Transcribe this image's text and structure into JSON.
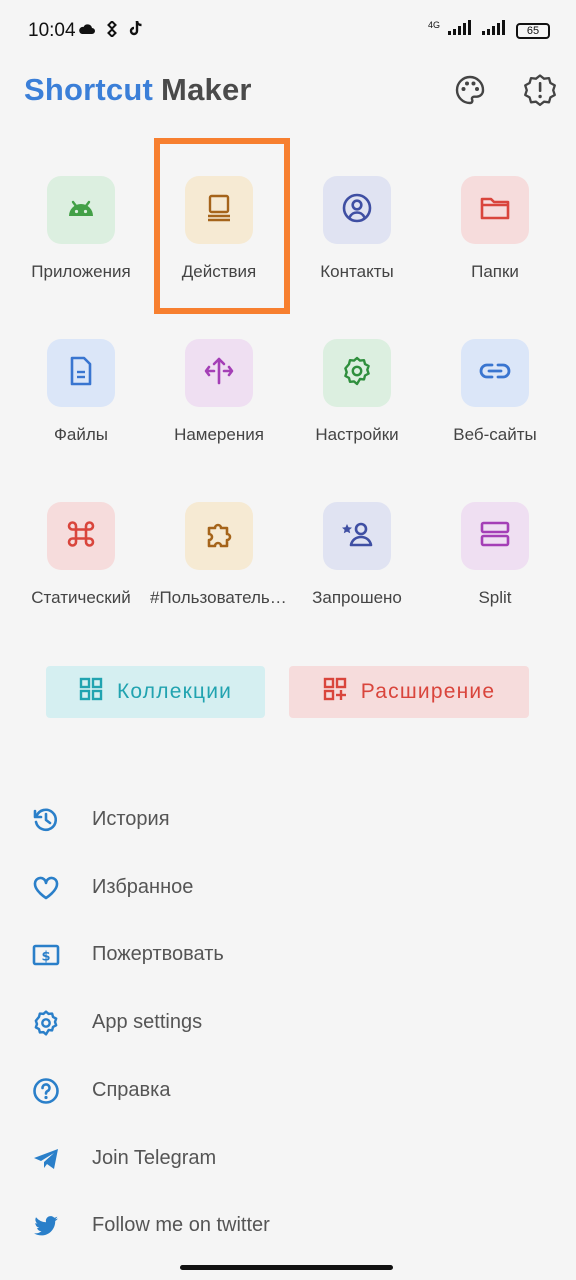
{
  "status_bar": {
    "time": "10:04",
    "network": "4G",
    "battery": "65",
    "icons": [
      "cloud-icon",
      "binance-icon",
      "tiktok-icon",
      "signal-icon",
      "signal-icon",
      "battery-icon"
    ]
  },
  "header": {
    "title_part1": "Shortcut",
    "title_part2": "Maker",
    "palette_icon": "palette-icon",
    "settings_icon": "settings-alert-icon"
  },
  "tiles": [
    {
      "label": "Приложения",
      "icon": "android-icon",
      "bg": "#dcefe0",
      "color": "#43a047"
    },
    {
      "label": "Действия",
      "icon": "activity-icon",
      "bg": "#f6ead3",
      "color": "#a5641a"
    },
    {
      "label": "Контакты",
      "icon": "contact-icon",
      "bg": "#e0e3f2",
      "color": "#3f4fa3"
    },
    {
      "label": "Папки",
      "icon": "folder-icon",
      "bg": "#f6dcdc",
      "color": "#d9453c"
    },
    {
      "label": "Файлы",
      "icon": "file-icon",
      "bg": "#dbe6f8",
      "color": "#3975d0"
    },
    {
      "label": "Намерения",
      "icon": "intent-icon",
      "bg": "#efdff2",
      "color": "#a43fb6"
    },
    {
      "label": "Настройки",
      "icon": "gear-icon",
      "bg": "#dcefe0",
      "color": "#2f8f3d"
    },
    {
      "label": "Веб-сайты",
      "icon": "link-icon",
      "bg": "#dbe6f8",
      "color": "#3975d0"
    },
    {
      "label": "Статический",
      "icon": "command-icon",
      "bg": "#f6dcdc",
      "color": "#d9453c"
    },
    {
      "label": "#Пользовательский",
      "icon": "puzzle-icon",
      "bg": "#f6ead3",
      "color": "#a5641a"
    },
    {
      "label": "Запрошено",
      "icon": "requested-user-icon",
      "bg": "#e0e3f2",
      "color": "#3f4fa3"
    },
    {
      "label": "Split",
      "icon": "split-icon",
      "bg": "#efdff2",
      "color": "#a43fb6"
    }
  ],
  "buttons": {
    "collections": {
      "label": "Коллекции",
      "icon": "grid-icon",
      "bg": "#d5eff1",
      "color": "#21a3b0"
    },
    "extension": {
      "label": "Расширение",
      "icon": "grid-add-icon",
      "bg": "#f6dcdc",
      "color": "#d9453c"
    }
  },
  "menu": [
    {
      "label": "История",
      "icon": "history-icon"
    },
    {
      "label": "Избранное",
      "icon": "heart-icon"
    },
    {
      "label": "Пожертвовать",
      "icon": "donate-icon"
    },
    {
      "label": "App settings",
      "icon": "settings-icon"
    },
    {
      "label": "Справка",
      "icon": "help-icon"
    },
    {
      "label": "Join Telegram",
      "icon": "telegram-icon"
    },
    {
      "label": "Follow me on twitter",
      "icon": "twitter-icon"
    }
  ],
  "colors": {
    "accent": "#3b7fd8",
    "menu_icon": "#2a7fc9",
    "highlight": "#f77f2f"
  }
}
